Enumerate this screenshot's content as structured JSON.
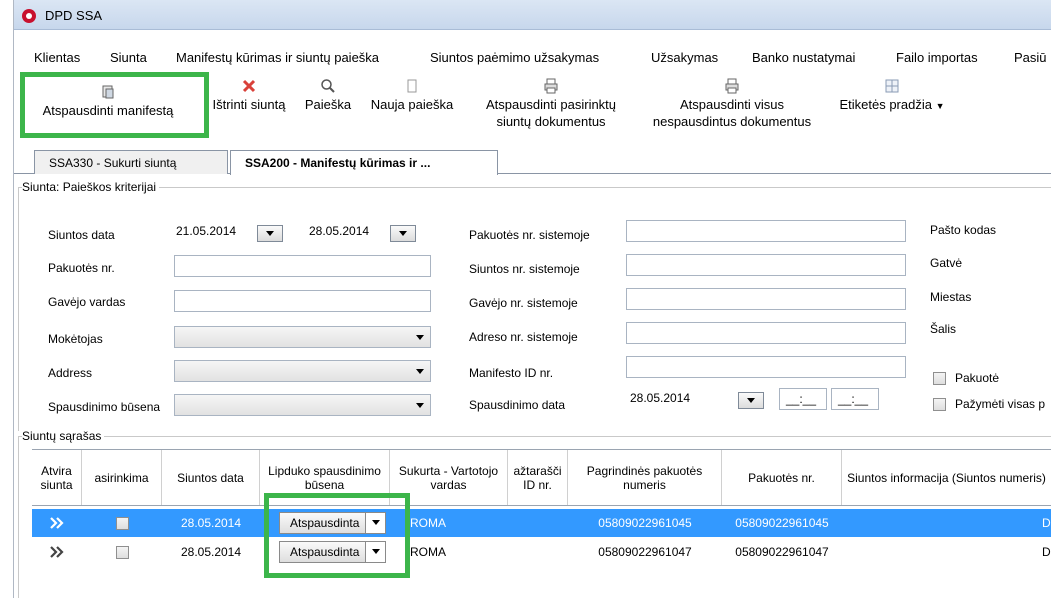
{
  "window": {
    "title": "DPD SSA"
  },
  "menu": [
    "Klientas",
    "Siunta",
    "Manifestų kūrimas ir siuntų paieška",
    "Siuntos paėmimo užsakymas",
    "Užsakymas",
    "Banko nustatymai",
    "Failo importas",
    "Pasiū"
  ],
  "toolbar": {
    "print_manifest": "Atspausdinti manifestą",
    "delete_shipment": "Ištrinti siuntą",
    "search": "Paieška",
    "new_search": "Nauja paieška",
    "print_selected_1": "Atspausdinti pasirinktų",
    "print_selected_2": "siuntų dokumentus",
    "print_all_1": "Atspausdinti visus",
    "print_all_2": "nespausdintus dokumentus",
    "label_start": "Etiketės pradžia"
  },
  "tabs": [
    "SSA330 - Sukurti siuntą",
    "SSA200 - Manifestų kūrimas ir ..."
  ],
  "search_group": {
    "title": "Siunta: Paieškos kriterijai",
    "labels": {
      "shipment_date": "Siuntos data",
      "package_no": "Pakuotės nr.",
      "recipient_name": "Gavėjo vardas",
      "payer": "Mokėtojas",
      "address": "Address",
      "print_status": "Spausdinimo būsena",
      "package_no_system": "Pakuotės nr. sistemoje",
      "shipment_no_system": "Siuntos nr. sistemoje",
      "recipient_no_system": "Gavėjo nr. sistemoje",
      "address_no_system": "Adreso nr. sistemoje",
      "manifest_id": "Manifesto ID nr.",
      "print_date": "Spausdinimo data",
      "postal_code": "Pašto kodas",
      "street": "Gatvė",
      "city": "Miestas",
      "country": "Šalis",
      "package_chk": "Pakuotė",
      "mark_all_chk": "Pažymėti visas p"
    },
    "date_from": "21.05.2014",
    "date_to": "28.05.2014",
    "print_date": "28.05.2014",
    "time_placeholder": "__:__"
  },
  "list_group": {
    "title": "Siuntų sąrašas",
    "columns": [
      "Atvira siunta",
      "asirinkima",
      "Siuntos data",
      "Lipduko spausdinimo būsena",
      "Sukurta - Vartotojo vardas",
      "ažtarašči ID nr.",
      "Pagrindinės pakuotės numeris",
      "Pakuotės nr.",
      "Siuntos informacija (Siuntos numeris)"
    ],
    "rows": [
      {
        "date": "28.05.2014",
        "status": "Atspausdinta",
        "user": "ROMA",
        "main_pkg": "05809022961045",
        "pkg": "05809022961045",
        "tail": "D"
      },
      {
        "date": "28.05.2014",
        "status": "Atspausdinta",
        "user": "ROMA",
        "main_pkg": "05809022961047",
        "pkg": "05809022961047",
        "tail": "D"
      }
    ]
  },
  "colors": {
    "selection": "#3399ff",
    "highlight": "#3cb54a",
    "titlebar": "#c7d7ec"
  }
}
